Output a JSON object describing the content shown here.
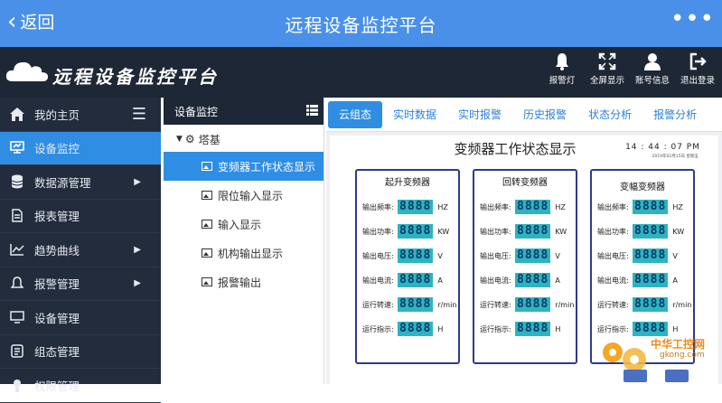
{
  "topbar": {
    "back_label": "返回",
    "title": "远程设备监控平台",
    "more": "•••"
  },
  "header": {
    "brand": "远程设备监控平台",
    "buttons": [
      {
        "icon": "bell-icon",
        "label": "报警灯"
      },
      {
        "icon": "fullscreen-icon",
        "label": "全屏显示"
      },
      {
        "icon": "user-icon",
        "label": "账号信息"
      },
      {
        "icon": "logout-icon",
        "label": "退出登录"
      }
    ]
  },
  "sidebar": {
    "items": [
      {
        "icon": "home-icon",
        "label": "我的主页"
      },
      {
        "icon": "monitor-icon",
        "label": "设备监控"
      },
      {
        "icon": "database-icon",
        "label": "数据源管理"
      },
      {
        "icon": "report-icon",
        "label": "报表管理"
      },
      {
        "icon": "trend-icon",
        "label": "趋势曲线"
      },
      {
        "icon": "alarm-icon",
        "label": "报警管理"
      },
      {
        "icon": "device-icon",
        "label": "设备管理"
      },
      {
        "icon": "config-icon",
        "label": "组态管理"
      },
      {
        "icon": "permission-icon",
        "label": "权限管理"
      }
    ]
  },
  "tree": {
    "header": "设备监控",
    "root": "塔基",
    "children": [
      "变频器工作状态显示",
      "限位输入显示",
      "输入显示",
      "机构输出显示",
      "报警输出"
    ]
  },
  "tabs": [
    "云组态",
    "实时数据",
    "实时报警",
    "历史报警",
    "状态分析",
    "报警分析"
  ],
  "panel": {
    "title": "变频器工作状态显示",
    "time": "14 : 44 : 07  PM",
    "date": "2019年02月15日  星期五",
    "led": "8888",
    "rows": [
      {
        "label": "输出频率:",
        "unit": "HZ"
      },
      {
        "label": "输出功率:",
        "unit": "KW"
      },
      {
        "label": "输出电压:",
        "unit": "V"
      },
      {
        "label": "输出电流:",
        "unit": "A"
      },
      {
        "label": "运行转速:",
        "unit": "r/min"
      },
      {
        "label": "运行指示:",
        "unit": "H"
      }
    ],
    "boxes": [
      "起升变频器",
      "回转变频器",
      "变幅变频器"
    ]
  },
  "watermark": {
    "line1": "中华工控网",
    "line2": "gkong.com"
  },
  "colors": {
    "topbar": "#4a90e8",
    "header": "#1e2735",
    "sidebar": "#222c3c",
    "active": "#2f8de4",
    "led": "#2db4c0"
  }
}
